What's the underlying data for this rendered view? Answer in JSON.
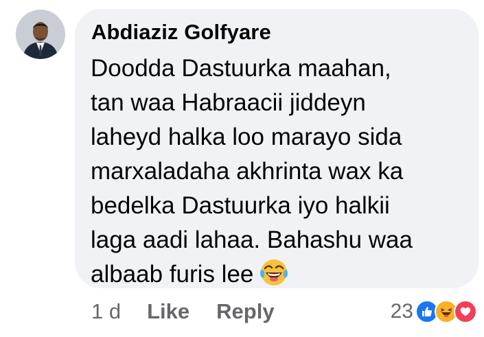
{
  "comment": {
    "author": "Abdiaziz Golfyare",
    "text_lines": [
      "Doodda Dastuurka maahan,",
      "tan waa Habraacii jiddeyn",
      "laheyd halka loo marayo sida",
      "marxaladaha akhrinta wax ka",
      "bedelka Dastuurka iyo halkii",
      "laga aadi lahaa. Bahashu waa",
      "albaab furis lee"
    ],
    "inline_emoji": "laughing-tears-emoji"
  },
  "actions": {
    "time": "1 d",
    "like": "Like",
    "reply": "Reply"
  },
  "reactions": {
    "count": "23",
    "icons": [
      "like-reaction",
      "haha-reaction",
      "love-reaction"
    ]
  },
  "colors": {
    "bubble": "#f0f2f5",
    "text": "#050505",
    "meta": "#65676b",
    "like_blue": "#1877f2",
    "love_red": "#f33e58",
    "haha_yellow": "#f7b125"
  }
}
